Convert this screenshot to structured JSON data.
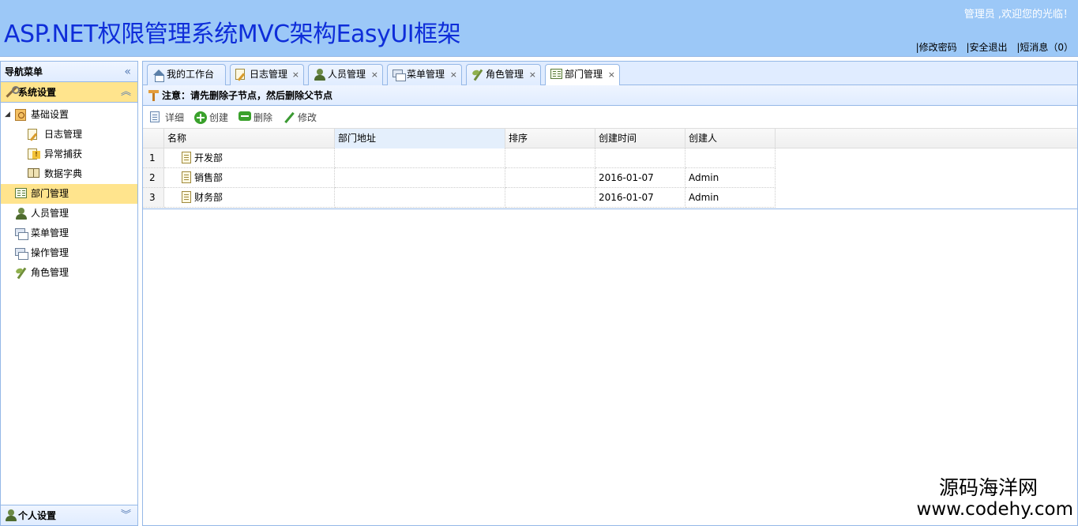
{
  "header": {
    "title": "ASP.NET权限管理系统MVC架构EasyUI框架",
    "welcome": "管理员 ,欢迎您的光临！",
    "links": [
      "|修改密码",
      "|安全退出",
      "|短消息（0）"
    ]
  },
  "sidebar": {
    "title": "导航菜单",
    "collapse_icon": "«",
    "section": "系统设置",
    "section_chevron": "︽",
    "tree": [
      {
        "label": "基础设置",
        "toggle": "◢"
      },
      {
        "label": "日志管理"
      },
      {
        "label": "异常捕获"
      },
      {
        "label": "数据字典"
      },
      {
        "label": "部门管理"
      },
      {
        "label": "人员管理"
      },
      {
        "label": "菜单管理"
      },
      {
        "label": "操作管理"
      },
      {
        "label": "角色管理"
      }
    ],
    "footer": "个人设置",
    "footer_chevron": "︾"
  },
  "tabs": [
    {
      "label": "我的工作台"
    },
    {
      "label": "日志管理",
      "close": "×"
    },
    {
      "label": "人员管理",
      "close": "×"
    },
    {
      "label": "菜单管理",
      "close": "×"
    },
    {
      "label": "角色管理",
      "close": "×"
    },
    {
      "label": "部门管理",
      "close": "×"
    }
  ],
  "notice": "注意：请先删除子节点，然后删除父节点",
  "toolbar": {
    "detail": "详细",
    "create": "创建",
    "delete": "删除",
    "edit": "修改"
  },
  "grid": {
    "columns": [
      "名称",
      "部门地址",
      "排序",
      "创建时间",
      "创建人"
    ],
    "rows": [
      {
        "num": "1",
        "name": "开发部",
        "address": "",
        "order": "",
        "created": "",
        "creator": ""
      },
      {
        "num": "2",
        "name": "销售部",
        "address": "",
        "order": "",
        "created": "2016-01-07",
        "creator": "Admin"
      },
      {
        "num": "3",
        "name": "财务部",
        "address": "",
        "order": "",
        "created": "2016-01-07",
        "creator": "Admin"
      }
    ]
  },
  "watermark": {
    "line1": "源码海洋网",
    "line2": "www.codehy.com"
  },
  "colors": {
    "header_bg": "#9cc8f7",
    "title": "#0e2dd9",
    "selected": "#ffe48d",
    "border": "#95b8e7"
  }
}
